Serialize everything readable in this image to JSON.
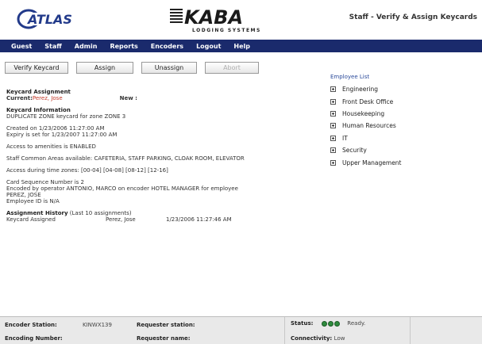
{
  "header": {
    "atlas_logo_text": "ATLAS",
    "kaba_logo_text": "KABA",
    "kaba_subtitle": "LODGING SYSTEMS",
    "page_title": "Staff - Verify & Assign Keycards"
  },
  "nav": [
    "Guest",
    "Staff",
    "Admin",
    "Reports",
    "Encoders",
    "Logout",
    "Help"
  ],
  "toolbar": {
    "verify": "Verify Keycard",
    "assign": "Assign",
    "unassign": "Unassign",
    "abort": "Abort"
  },
  "assignment": {
    "title": "Keycard Assignment",
    "current_label": "Current:",
    "current_value": "Perez, Jose",
    "new_label": "New :"
  },
  "info": {
    "title": "Keycard Information",
    "line1": "DUPLICATE ZONE keycard for zone ZONE 3",
    "created": "Created on 1/23/2006 11:27:00 AM",
    "expiry": "Expiry is set for 1/23/2007 11:27:00 AM",
    "amenities": "Access to amenities is ENABLED",
    "common_areas": "Staff Common Areas available: CAFETERIA, STAFF PARKING, CLOAK ROOM, ELEVATOR",
    "time_zones": "Access during time zones: [00-04] [04-08] [08-12] [12-16]",
    "sequence": "Card Sequence Number is 2",
    "encoded_by": "Encoded by operator ANTONIO, MARCO on encoder HOTEL MANAGER for employee",
    "employee": "PEREZ, JOSE",
    "employee_id": "Employee ID is N/A"
  },
  "history": {
    "title": "Assignment History",
    "subtitle": "(Last 10 assignments)",
    "rows": [
      {
        "action": "Keycard Assigned",
        "name": "Perez, Jose",
        "date": "1/23/2006 11:27:46 AM"
      }
    ]
  },
  "employee_list": {
    "title": "Employee List",
    "items": [
      "Engineering",
      "Front Desk Office",
      "Housekeeping",
      "Human Resources",
      "IT",
      "Security",
      "Upper Management"
    ]
  },
  "status_bar": {
    "encoder_station_label": "Encoder Station:",
    "encoder_station_value": "KINWX139",
    "encoding_number_label": "Encoding Number:",
    "requester_station_label": "Requester station:",
    "requester_name_label": "Requester name:",
    "status_label": "Status:",
    "status_value": "Ready.",
    "connectivity_label": "Connectivity:",
    "connectivity_value": "Low",
    "status_color": "#2e8b3e"
  }
}
